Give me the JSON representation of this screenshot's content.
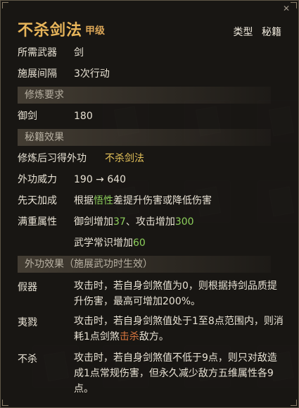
{
  "title": {
    "name": "不杀剑法",
    "grade": "甲级"
  },
  "type": {
    "label": "类型",
    "value": "秘籍"
  },
  "info": [
    {
      "key": "所需武器",
      "value": "剑"
    },
    {
      "key": "施展间隔",
      "value": "3次行动"
    }
  ],
  "sections": {
    "requirements": "修炼要求",
    "secret_effects": "秘籍效果",
    "outer_effects": "外功效果（施展武功时生效）"
  },
  "requirements": [
    {
      "key": "御剑",
      "value": "180"
    }
  ],
  "secret": {
    "learn_key": "修炼后习得外功",
    "learn_value": "不杀剑法",
    "power_key": "外功威力",
    "power_value": "190 → 640",
    "innate_key": "先天加成",
    "innate_prefix": "根据",
    "innate_highlight": "悟性",
    "innate_suffix": "差提升伤害或降低伤害",
    "full_key": "满重属性",
    "full_line1_a": "御剑增加",
    "full_line1_b": "37",
    "full_line1_c": "、攻击增加",
    "full_line1_d": "300",
    "full_line2_a": "武学常识增加",
    "full_line2_b": "60"
  },
  "effects": [
    {
      "key": "假器",
      "text": "攻击时，若自身剑煞值为0，则根据持剑品质提升伤害，最高可增加200%。"
    },
    {
      "key": "夷戮",
      "text_a": "攻击时，若自身剑煞值处于1至8点范围内，则消耗1点剑煞",
      "text_hl": "击杀",
      "text_b": "敌方。"
    },
    {
      "key": "不杀",
      "text": "攻击时，若自身剑煞值不低于9点，则只对敌造成1点常规伤害，但永久减少敌方五维属性各9点。"
    }
  ],
  "colors": {
    "title": "#e7b55a",
    "highlight_gold": "#e6c35a",
    "highlight_green": "#8ccf5b",
    "highlight_orange": "#d8753f"
  }
}
